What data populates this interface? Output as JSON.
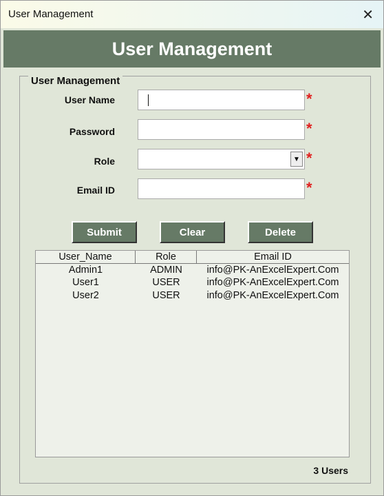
{
  "window": {
    "title": "User Management",
    "close_icon": "close-icon"
  },
  "header": {
    "title": "User Management"
  },
  "form": {
    "legend": "User Management",
    "fields": [
      {
        "label": "User Name",
        "value": ""
      },
      {
        "label": "Password",
        "value": ""
      },
      {
        "label": "Role",
        "value": ""
      },
      {
        "label": "Email ID",
        "value": ""
      }
    ],
    "required_marker": "*"
  },
  "buttons": {
    "submit": "Submit",
    "clear": "Clear",
    "delete": "Delete"
  },
  "table": {
    "columns": [
      "User_Name",
      "Role",
      "Email ID"
    ],
    "rows": [
      [
        "Admin1",
        "ADMIN",
        "info@PK-AnExcelExpert.Com"
      ],
      [
        "User1",
        "USER",
        "info@PK-AnExcelExpert.Com"
      ],
      [
        "User2",
        "USER",
        "info@PK-AnExcelExpert.Com"
      ]
    ]
  },
  "status": {
    "count": "3 Users"
  },
  "colors": {
    "accent": "#667a66",
    "background": "#e0e6d8",
    "required": "#e02020"
  }
}
